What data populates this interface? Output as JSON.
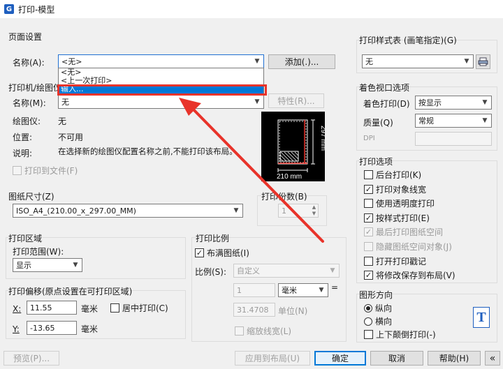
{
  "window": {
    "title": "打印-模型",
    "icon_glyph": "G"
  },
  "page_setup": {
    "title": "页面设置",
    "name_label": "名称(A):",
    "name_value": "<无>",
    "add_button": "添加(.)...",
    "dropdown_options": [
      "<无>",
      "<上一次打印>",
      "输入..."
    ]
  },
  "printer": {
    "title": "打印机/绘图仪",
    "name_label": "名称(M):",
    "name_value": "无",
    "properties_button": "特性(R)...",
    "plotter_label": "绘图仪:",
    "plotter_value": "无",
    "location_label": "位置:",
    "location_value": "不可用",
    "description_label": "说明:",
    "description_value": "在选择新的绘图仪配置名称之前,不能打印该布局。",
    "print_to_file": "打印到文件(F)"
  },
  "preview": {
    "width_label": "210 mm",
    "height_label": "297 mm"
  },
  "paper_size": {
    "title": "图纸尺寸(Z)",
    "value": "ISO_A4_(210.00_x_297.00_MM)"
  },
  "copies": {
    "title": "打印份数(B)",
    "value": "1"
  },
  "print_area": {
    "title": "打印区域",
    "range_label": "打印范围(W):",
    "range_value": "显示"
  },
  "print_scale": {
    "title": "打印比例",
    "fit_paper": "布满图纸(I)",
    "scale_label": "比例(S):",
    "scale_value": "自定义",
    "value1": "1",
    "unit": "毫米",
    "equals": "=",
    "value2": "31.4708",
    "unit_label": "单位(N)",
    "scale_lineweights": "缩放线宽(L)"
  },
  "offset": {
    "title": "打印偏移(原点设置在可打印区域)",
    "x_label": "X:",
    "x_value": "11.55",
    "x_unit": "毫米",
    "center": "居中打印(C)",
    "y_label": "Y:",
    "y_value": "-13.65",
    "y_unit": "毫米"
  },
  "plot_style": {
    "title": "打印样式表 (画笔指定)(G)",
    "value": "无"
  },
  "shaded_viewport": {
    "title": "着色视口选项",
    "shade_label": "着色打印(D)",
    "shade_value": "按显示",
    "quality_label": "质量(Q)",
    "quality_value": "常规",
    "dpi_label": "DPI"
  },
  "plot_options": {
    "title": "打印选项",
    "items": [
      {
        "label": "后台打印(K)",
        "checked": false,
        "enabled": true
      },
      {
        "label": "打印对象线宽",
        "checked": true,
        "enabled": true
      },
      {
        "label": "使用透明度打印",
        "checked": false,
        "enabled": true
      },
      {
        "label": "按样式打印(E)",
        "checked": true,
        "enabled": true
      },
      {
        "label": "最后打印图纸空间",
        "checked": true,
        "enabled": false
      },
      {
        "label": "隐藏图纸空间对象(J)",
        "checked": false,
        "enabled": false
      },
      {
        "label": "打开打印戳记",
        "checked": false,
        "enabled": true
      },
      {
        "label": "将修改保存到布局(V)",
        "checked": true,
        "enabled": true
      }
    ]
  },
  "orientation": {
    "title": "图形方向",
    "portrait": "纵向",
    "landscape": "横向",
    "upside_down": "上下颠倒打印(-)",
    "icon_letter": "T"
  },
  "footer": {
    "preview_button": "预览(P)...",
    "apply_button": "应用到布局(U)",
    "ok_button": "确定",
    "cancel_button": "取消",
    "help_button": "帮助(H)",
    "collapse_button": "«"
  },
  "colors": {
    "highlight": "#e8332a",
    "accent": "#0078d7"
  }
}
